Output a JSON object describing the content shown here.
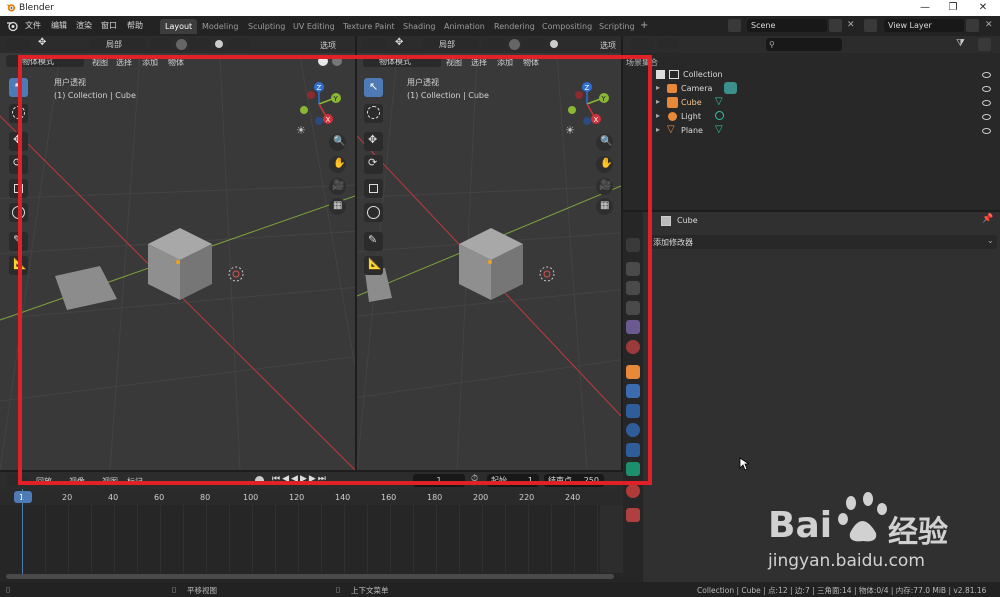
{
  "window": {
    "title": "Blender",
    "controls": [
      "—",
      "❐",
      "✕"
    ]
  },
  "menu": [
    "文件",
    "编辑",
    "渲染",
    "窗口",
    "帮助"
  ],
  "workspaces": [
    "Layout",
    "Modeling",
    "Sculpting",
    "UV Editing",
    "Texture Paint",
    "Shading",
    "Animation",
    "Rendering",
    "Compositing",
    "Scripting"
  ],
  "scene": {
    "name": "Scene",
    "view_layer": "View Layer"
  },
  "viewport": {
    "transform_orientation": "局部",
    "options_label": "选项",
    "mode": "物体模式",
    "header_menu": [
      "视图",
      "选择",
      "添加",
      "物体"
    ],
    "view_name": "用户透视",
    "collection_info": "(1) Collection | Cube",
    "gizmo": {
      "z": "Z",
      "y": "Y",
      "x": "X"
    },
    "colors": {
      "x_axis": "#d0323a",
      "y_axis": "#8ab833",
      "z_axis": "#2f6fd6"
    }
  },
  "outliner": {
    "title": "场景集合",
    "rows": [
      {
        "name": "Collection"
      },
      {
        "name": "Camera"
      },
      {
        "name": "Cube"
      },
      {
        "name": "Light"
      },
      {
        "name": "Plane"
      }
    ]
  },
  "properties": {
    "object_name": "Cube",
    "add_modifier": "添加修改器"
  },
  "timeline": {
    "menu": [
      "回放",
      "视像",
      "视图",
      "标记"
    ],
    "current_frame": "1",
    "start_label": "起始",
    "start_value": "1",
    "end_label": "结束点",
    "end_value": "250",
    "ticks": [
      "1",
      "20",
      "40",
      "60",
      "80",
      "100",
      "120",
      "140",
      "160",
      "180",
      "200",
      "220",
      "240"
    ]
  },
  "status": {
    "pan": "平移视图",
    "context": "上下文菜单",
    "info": "Collection | Cube | 点:12 | 边:7 | 三角面:14 | 物体:0/4 | 内存:77.0 MiB | v2.81.16"
  },
  "watermark": {
    "brand": "Bai",
    "brand2": "经验",
    "url": "jingyan.baidu.com"
  },
  "highlight_color": "#e02128"
}
